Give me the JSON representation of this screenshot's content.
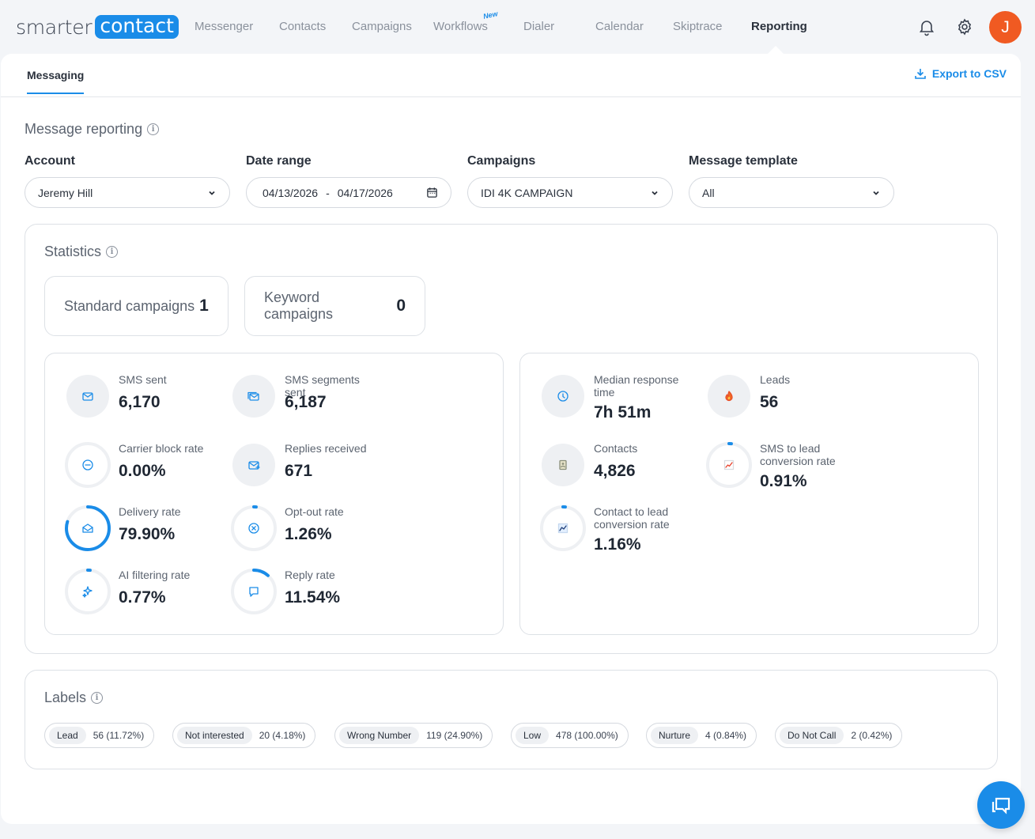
{
  "logo": {
    "part1": "smarter",
    "part2": "contact"
  },
  "nav": {
    "items": [
      "Messenger",
      "Contacts",
      "Campaigns",
      "Workflows",
      "Dialer",
      "Calendar",
      "Skiptrace",
      "Reporting"
    ],
    "new_badge": "New",
    "active": "Reporting",
    "avatar_initial": "J"
  },
  "subtabs": {
    "messaging": "Messaging",
    "export": "Export to CSV"
  },
  "filters": {
    "title": "Message reporting",
    "account_label": "Account",
    "account_value": "Jeremy Hill",
    "date_label": "Date range",
    "date_from": "04/13/2026",
    "date_sep": "-",
    "date_to": "04/17/2026",
    "campaigns_label": "Campaigns",
    "campaigns_value": "IDI 4K CAMPAIGN",
    "template_label": "Message template",
    "template_value": "All"
  },
  "statistics": {
    "title": "Statistics",
    "standard_label": "Standard campaigns",
    "standard_count": "1",
    "keyword_label": "Keyword campaigns",
    "keyword_count": "0",
    "left": [
      {
        "label": "SMS sent",
        "value": "6,170",
        "icon": "envelope-icon",
        "progress": null
      },
      {
        "label": "SMS segments sent",
        "value": "6,187",
        "icon": "stacked-envelope-icon",
        "progress": null
      },
      {
        "label": "Carrier block rate",
        "value": "0.00%",
        "icon": "block-icon",
        "progress": 0.0
      },
      {
        "label": "Replies received",
        "value": "671",
        "icon": "envelope-plus-icon",
        "progress": null
      },
      {
        "label": "Delivery rate",
        "value": "79.90%",
        "icon": "open-envelope-icon",
        "progress": 0.799
      },
      {
        "label": "Opt-out rate",
        "value": "1.26%",
        "icon": "x-circle-icon",
        "progress": 0.0126
      },
      {
        "label": "AI filtering rate",
        "value": "0.77%",
        "icon": "sparkle-icon",
        "progress": 0.0077
      },
      {
        "label": "Reply rate",
        "value": "11.54%",
        "icon": "chat-icon",
        "progress": 0.1154
      }
    ],
    "right": [
      {
        "label": "Median response time",
        "value": "7h 51m",
        "icon": "clock-icon",
        "progress": null
      },
      {
        "label": "Leads",
        "value": "56",
        "icon": "fire-icon",
        "progress": null
      },
      {
        "label": "Contacts",
        "value": "4,826",
        "icon": "contact-card-icon",
        "progress": null
      },
      {
        "label": "SMS to lead conversion rate",
        "value": "0.91%",
        "icon": "trend-chart-icon",
        "progress": 0.0091
      },
      {
        "label": "Contact to lead conversion rate",
        "value": "1.16%",
        "icon": "trend-line-icon",
        "progress": 0.0116
      }
    ]
  },
  "labels": {
    "title": "Labels",
    "chips": [
      {
        "tag": "Lead",
        "count": "56 (11.72%)"
      },
      {
        "tag": "Not interested",
        "count": "20 (4.18%)"
      },
      {
        "tag": "Wrong Number",
        "count": "119 (24.90%)"
      },
      {
        "tag": "Low",
        "count": "478 (100.00%)"
      },
      {
        "tag": "Nurture",
        "count": "4 (0.84%)"
      },
      {
        "tag": "Do Not Call",
        "count": "2 (0.42%)"
      }
    ]
  },
  "colors": {
    "accent": "#1a8ce8",
    "avatar": "#f05a22",
    "ring_track": "#eef0f3"
  }
}
